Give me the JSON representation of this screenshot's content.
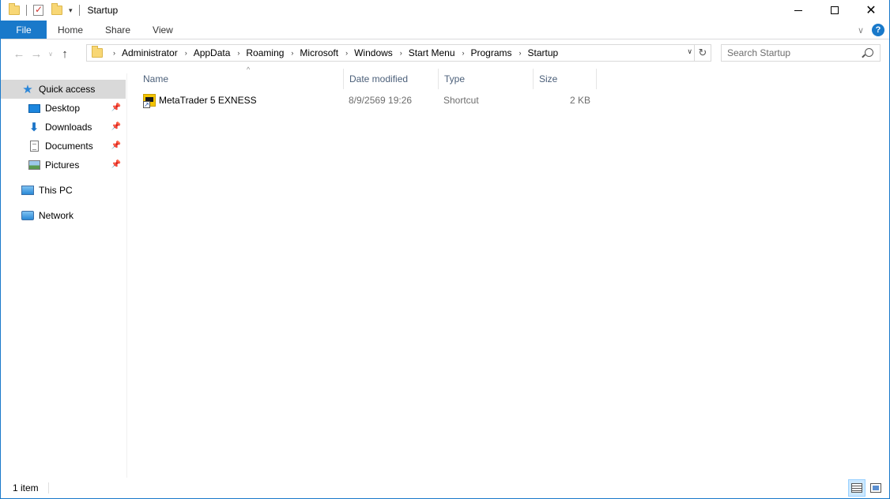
{
  "window": {
    "title": "Startup"
  },
  "ribbon": {
    "tabs": [
      "File",
      "Home",
      "Share",
      "View"
    ]
  },
  "address": {
    "crumbs": [
      "Administrator",
      "AppData",
      "Roaming",
      "Microsoft",
      "Windows",
      "Start Menu",
      "Programs",
      "Startup"
    ]
  },
  "search": {
    "placeholder": "Search Startup"
  },
  "navpane": {
    "quick_access": "Quick access",
    "pinned": [
      "Desktop",
      "Downloads",
      "Documents",
      "Pictures"
    ],
    "this_pc": "This PC",
    "network": "Network"
  },
  "columns": {
    "name": "Name",
    "date": "Date modified",
    "type": "Type",
    "size": "Size"
  },
  "files": [
    {
      "name": "MetaTrader 5 EXNESS",
      "date": "8/9/2569 19:26",
      "type": "Shortcut",
      "size": "2 KB",
      "icon": "metatrader-shortcut-icon"
    }
  ],
  "status": {
    "count": "1 item"
  },
  "colors": {
    "accent": "#1979ca",
    "selection": "#d9d9d9",
    "header_text": "#4c607a"
  }
}
